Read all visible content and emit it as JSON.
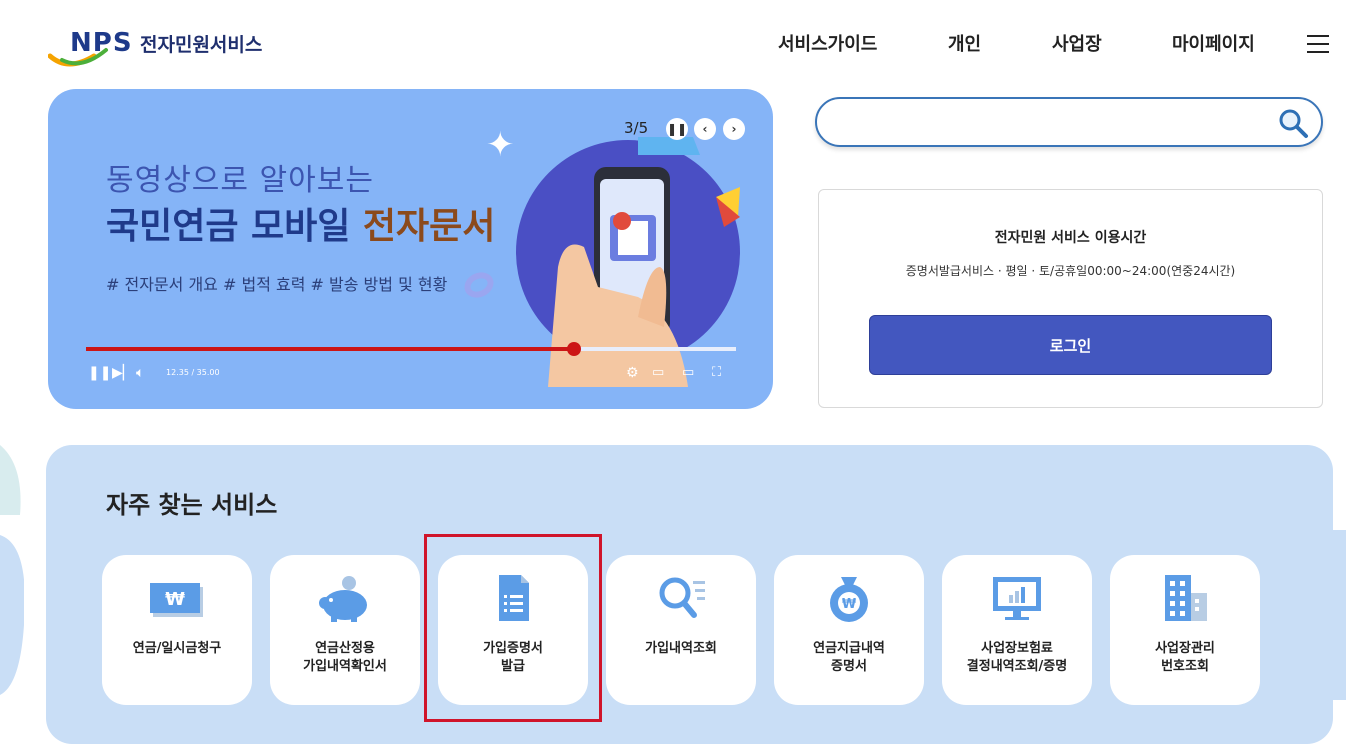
{
  "header": {
    "logo_text": "NPS",
    "site_title": "전자민원서비스",
    "nav": [
      "서비스가이드",
      "개인",
      "사업장",
      "마이페이지"
    ]
  },
  "banner": {
    "line1": "동영상으로 알아보는",
    "line2_main": "국민연금 모바일 ",
    "line2_accent": "전자문서",
    "tags": "# 전자문서 개요  # 법적 효력  # 발송 방법 및 현황",
    "slide_counter": "3/5",
    "time": "12.35 / 35.00",
    "progress": 0.75,
    "icons": {
      "pause": "pause-icon",
      "prev": "chevron-left-icon",
      "next": "chevron-right-icon",
      "play_pause": "pause-icon",
      "skip": "skip-next-icon",
      "volume": "volume-icon",
      "settings": "settings-hd-icon",
      "miniplayer": "miniplayer-icon",
      "theater": "theater-icon",
      "fullscreen": "fullscreen-icon"
    }
  },
  "search": {
    "placeholder": "",
    "value": ""
  },
  "info": {
    "title": "전자민원 서비스 이용시간",
    "desc": "증명서발급서비스 · 평일 · 토/공휴일00:00~24:00(연중24시간)",
    "login_label": "로그인"
  },
  "services": {
    "title": "자주 찾는 서비스",
    "items": [
      {
        "label": "연금/일시금청구",
        "icon": "won-bill-icon"
      },
      {
        "label": "연금산정용\n가입내역확인서",
        "icon": "piggy-bank-icon"
      },
      {
        "label": "가입증명서\n발급",
        "icon": "document-icon"
      },
      {
        "label": "가입내역조회",
        "icon": "search-list-icon"
      },
      {
        "label": "연금지급내역\n증명서",
        "icon": "money-bag-icon"
      },
      {
        "label": "사업장보험료\n결정내역조회/증명",
        "icon": "monitor-chart-icon"
      },
      {
        "label": "사업장관리\n번호조회",
        "icon": "building-icon"
      }
    ],
    "highlighted_index": 2
  },
  "colors": {
    "brand_blue": "#4357bf",
    "banner_bg": "#85b4f7",
    "services_bg": "#c9def6",
    "highlight": "#d0142a",
    "icon_blue": "#5b9ce6"
  }
}
